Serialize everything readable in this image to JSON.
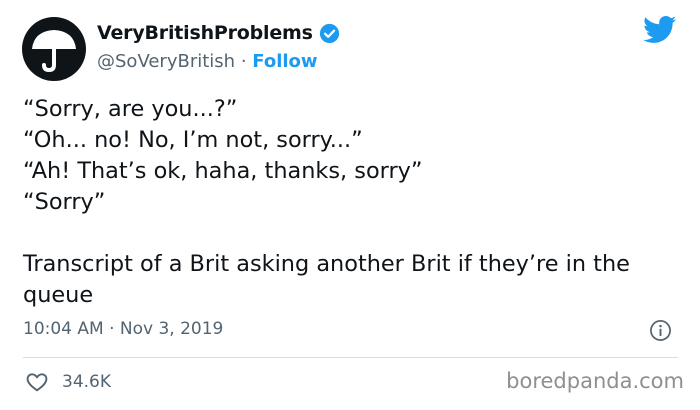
{
  "tweet": {
    "author": {
      "display_name": "VeryBritishProblems",
      "handle": "@SoVeryBritish",
      "separator": "·",
      "follow_label": "Follow",
      "verified": true
    },
    "lines": [
      "“Sorry, are you...?”",
      "“Oh... no! No, I’m not, sorry...”",
      "“Ah! That’s ok, haha, thanks, sorry”",
      "“Sorry”"
    ],
    "caption": "Transcript of a Brit asking another Brit if they’re in the queue",
    "timestamp": "10:04 AM · Nov 3, 2019",
    "likes": "34.6K"
  },
  "watermark": "boredpanda.com",
  "colors": {
    "accent": "#1d9bf0",
    "text": "#0f1419",
    "secondary": "#536471",
    "divider": "#d8dee3"
  },
  "icons": [
    "umbrella-avatar",
    "verified-badge-icon",
    "twitter-bird-icon",
    "info-icon",
    "heart-icon"
  ]
}
